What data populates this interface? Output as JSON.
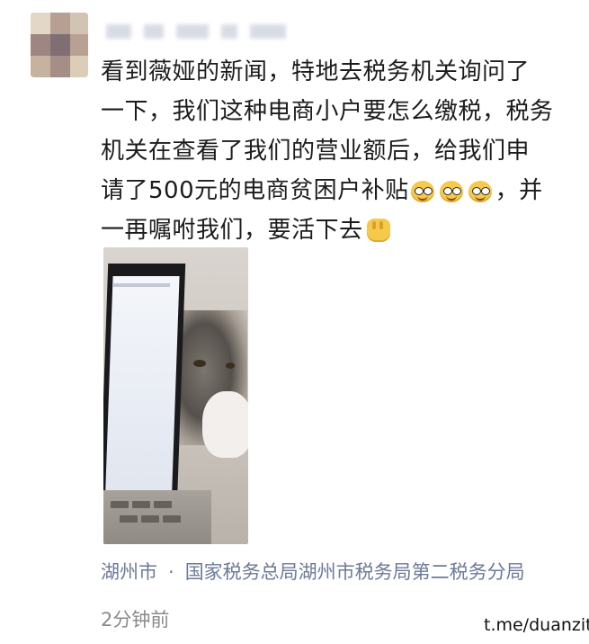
{
  "post": {
    "author_name": "",
    "body_lines": [
      "看到薇娅的新闻，特地去税务机关询问了",
      "一下，我们这种电商小户要怎么缴税，税务",
      "机关在查看了我们的营业额后，给我们申",
      "请了500元的电商贫困户补贴",
      "，并",
      "一再嘱咐我们，要活下去"
    ],
    "emoji_names": [
      "hot-face-emoji",
      "hot-face-emoji",
      "hot-face-emoji",
      "raised-fist-emoji"
    ],
    "location": "湖州市",
    "location_separator": "·",
    "location_detail": "国家税务总局湖州市税务局第二税务分局",
    "time": "2分钟前"
  },
  "watermark": "t.me/duanzitg"
}
